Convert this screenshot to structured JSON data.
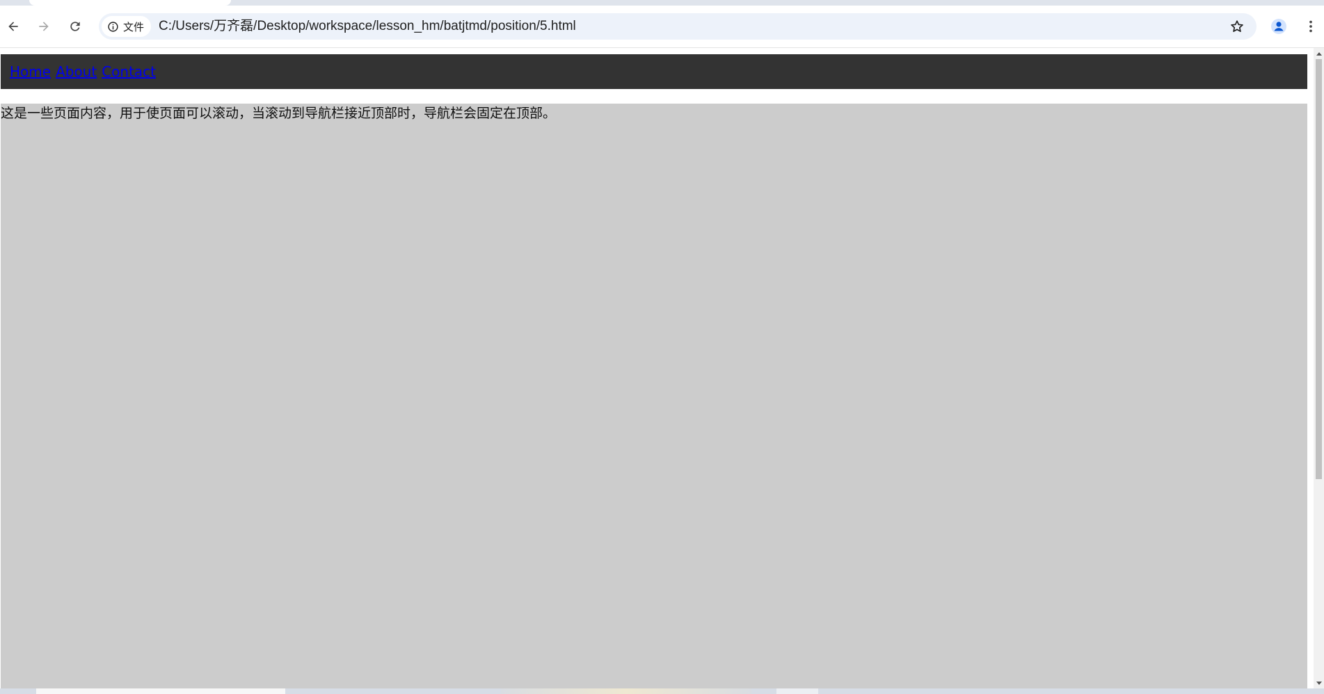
{
  "browser": {
    "toolbar": {
      "back_icon": "arrow-left-icon",
      "forward_icon": "arrow-right-icon",
      "reload_icon": "reload-icon"
    },
    "omnibox": {
      "security_chip_icon": "info-circle-icon",
      "security_chip_label": "文件",
      "url": "C:/Users/万齐磊/Desktop/workspace/lesson_hm/batjtmd/position/5.html",
      "bookmark_icon": "star-outline-icon"
    },
    "profile_icon": "person-icon",
    "menu_icon": "kebab-menu-icon"
  },
  "page": {
    "navbar": {
      "links": [
        "Home",
        "About",
        "Contact"
      ],
      "background": "#333333",
      "link_color": "#0000ee"
    },
    "content": {
      "text": "这是一些页面内容，用于使页面可以滚动，当滚动到导航栏接近顶部时，导航栏会固定在顶部。",
      "background": "#cccccc"
    }
  },
  "colors": {
    "omnibox_bg": "#edf2fa",
    "profile_accent": "#0b57d0"
  }
}
